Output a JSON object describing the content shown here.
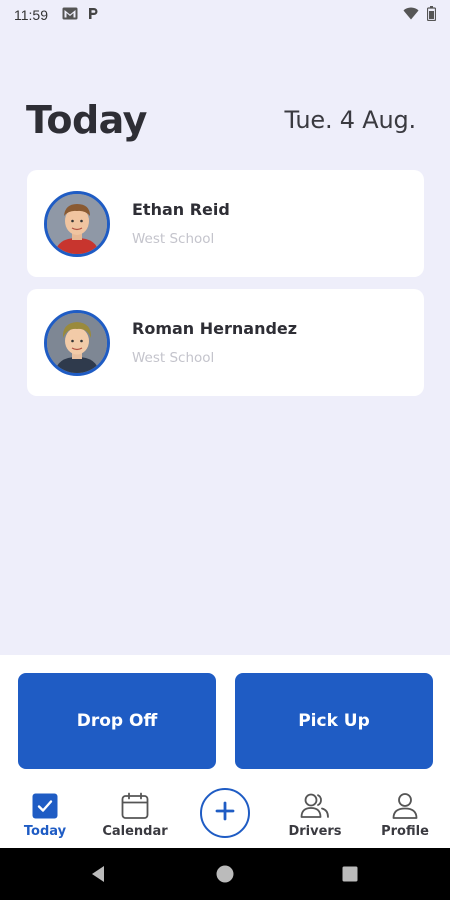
{
  "status_bar": {
    "time": "11:59",
    "left_icons": [
      "gmail-icon",
      "parking-icon"
    ],
    "right_icons": [
      "wifi-icon",
      "battery-icon"
    ]
  },
  "header": {
    "title": "Today",
    "date": "Tue. 4 Aug."
  },
  "students": [
    {
      "name": "Ethan Reid",
      "school": "West School",
      "avatar": "avatar-photo"
    },
    {
      "name": "Roman Hernandez",
      "school": "West School",
      "avatar": "avatar-photo"
    }
  ],
  "actions": {
    "drop_off": "Drop Off",
    "pick_up": "Pick Up"
  },
  "bottom_nav": {
    "items": [
      {
        "label": "Today",
        "icon": "checkbox-icon",
        "active": true
      },
      {
        "label": "Calendar",
        "icon": "calendar-icon",
        "active": false
      },
      {
        "label": "",
        "icon": "plus-icon",
        "active": false
      },
      {
        "label": "Drivers",
        "icon": "users-icon",
        "active": false
      },
      {
        "label": "Profile",
        "icon": "user-icon",
        "active": false
      }
    ]
  },
  "colors": {
    "accent": "#1F5CC4",
    "background": "#EEEEFA",
    "card": "#FFFFFF",
    "text_primary": "#2E2E35",
    "text_muted": "#C4C4CC"
  }
}
